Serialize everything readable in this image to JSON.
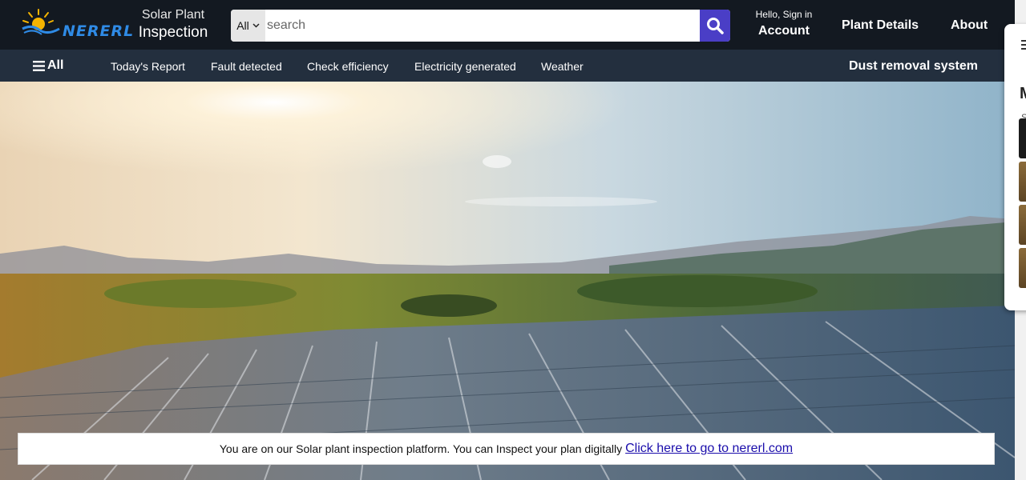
{
  "header": {
    "logo_text": "NERERL",
    "brand_line1": "Solar Plant",
    "brand_line2": "Inspection",
    "search": {
      "category": "All",
      "placeholder": "search"
    },
    "account_greeting": "Hello, Sign in",
    "account_label": "Account",
    "nav_plant_details": "Plant Details",
    "nav_about": "About"
  },
  "subnav": {
    "all_label": "All",
    "items": [
      "Today's Report",
      "Fault detected",
      "Check efficiency",
      "Electricity generated",
      "Weather"
    ],
    "dust_label": "Dust removal system"
  },
  "banner": {
    "text": "You are on our Solar plant inspection platform. You can Inspect your plan digitally",
    "link_text": "Click here to go to nererl.com"
  },
  "side_panel": {
    "letter": "M",
    "small": "S"
  },
  "colors": {
    "topbar": "#131921",
    "subnav": "#232f3e",
    "search_button": "#4a3ec6",
    "link": "#1a0dab"
  },
  "icons": [
    "sun-logo-icon",
    "chevron-down-icon",
    "search-icon",
    "hamburger-menu-icon"
  ]
}
